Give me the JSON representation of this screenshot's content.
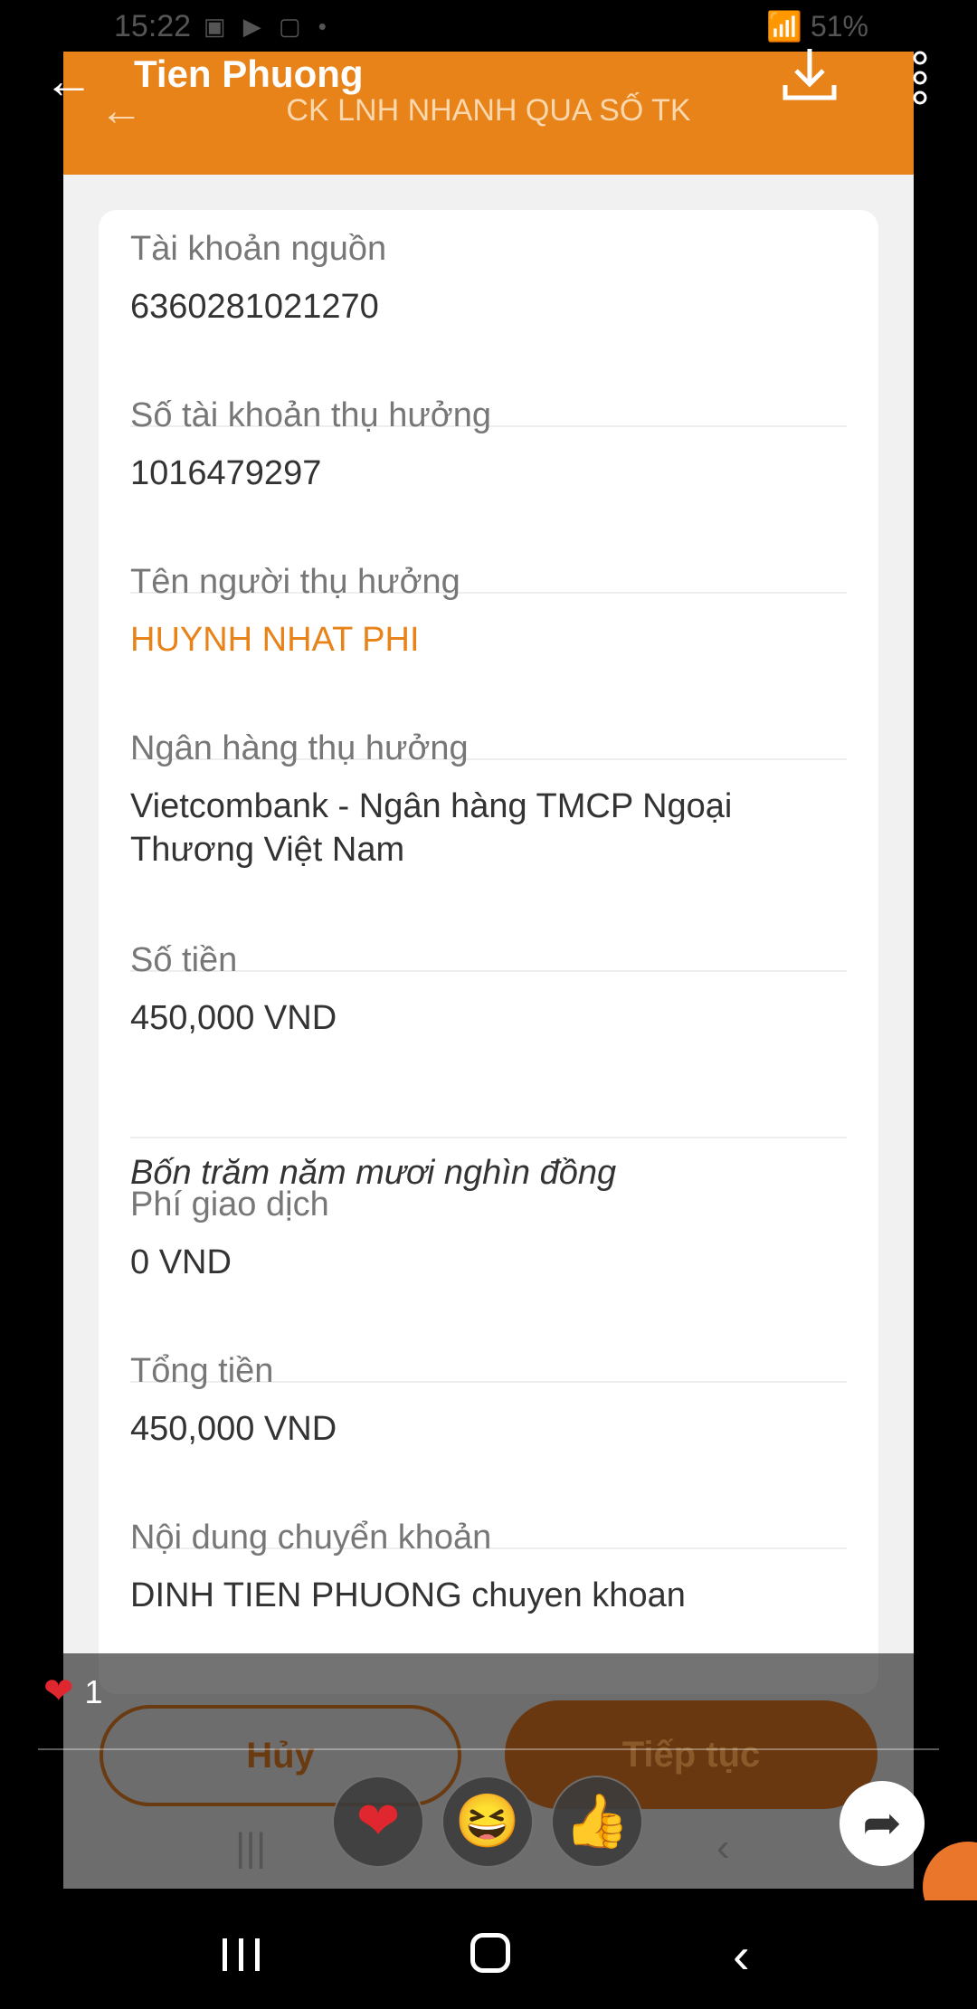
{
  "status_bar": {
    "time": "15:22",
    "battery": "51%"
  },
  "viewer": {
    "title": "Tien Phuong",
    "reaction_count": "1"
  },
  "screen": {
    "header_title": "CK LNH NHANH QUA SỐ TK",
    "fields": [
      {
        "label": "Tài khoản nguồn",
        "value": "6360281021270"
      },
      {
        "label": "Số tài khoản thụ hưởng",
        "value": "1016479297"
      },
      {
        "label": "Tên người thụ hưởng",
        "value": "HUYNH NHAT PHI"
      },
      {
        "label": "Ngân hàng thụ hưởng",
        "value": "Vietcombank - Ngân hàng TMCP Ngoại Thương Việt Nam"
      },
      {
        "label": "Số tiền",
        "value": "450,000 VND",
        "words": "Bốn trăm năm mươi nghìn đồng"
      },
      {
        "label": "Phí giao dịch",
        "value": "0 VND"
      },
      {
        "label": "Tổng tiền",
        "value": "450,000 VND"
      },
      {
        "label": "Nội dung chuyển khoản",
        "value": "DINH TIEN PHUONG chuyen khoan"
      }
    ],
    "cancel_label": "Hủy",
    "continue_label": "Tiếp tục"
  },
  "icons": {
    "back": "arrow-left-icon",
    "download": "download-icon",
    "more": "more-vertical-icon",
    "share": "share-icon",
    "reactions": [
      "heart-icon",
      "laugh-icon",
      "thumbs-up-icon"
    ]
  },
  "colors": {
    "accent": "#e8831a",
    "heart": "#e0262e"
  }
}
